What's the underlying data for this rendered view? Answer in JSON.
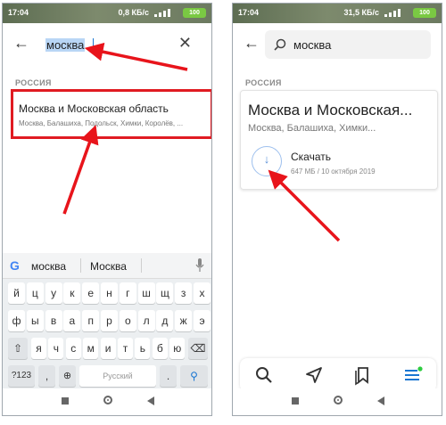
{
  "left": {
    "status": {
      "time": "17:04",
      "net": "0,8 КБ/с",
      "battery": "100"
    },
    "search": {
      "query": "москва"
    },
    "section_label": "РОССИЯ",
    "result": {
      "title": "Москва и Московская область",
      "subtitle": "Москва, Балашиха, Подольск, Химки, Королёв, ..."
    },
    "keyboard": {
      "suggestions": [
        "москва",
        "Москва"
      ],
      "row1": [
        "й",
        "ц",
        "у",
        "к",
        "е",
        "н",
        "г",
        "ш",
        "щ",
        "з",
        "х"
      ],
      "row2": [
        "ф",
        "ы",
        "в",
        "а",
        "п",
        "р",
        "о",
        "л",
        "д",
        "ж",
        "э"
      ],
      "row3": [
        "я",
        "ч",
        "с",
        "м",
        "и",
        "т",
        "ь",
        "б",
        "ю"
      ],
      "symbols_key": "?123",
      "comma": ",",
      "space_label": "Русский",
      "period": "."
    }
  },
  "right": {
    "status": {
      "time": "17:04",
      "net": "31,5 КБ/с",
      "battery": "100"
    },
    "search": {
      "query": "москва"
    },
    "section_label": "РОССИЯ",
    "card": {
      "title": "Москва и Московская...",
      "subtitle": "Москва, Балашиха, Химки...",
      "download_label": "Скачать",
      "download_meta": "647 МБ / 10 октября 2019"
    }
  },
  "colors": {
    "accent": "#1976d2",
    "highlight_red": "#e01b22",
    "arrow_red": "#e8141b",
    "battery_green": "#7ac943",
    "download_blue": "#5d92d9",
    "tab_dot_green": "#2ecc40"
  },
  "icons": [
    "back-arrow-icon",
    "clear-icon",
    "search-icon",
    "google-icon",
    "mic-icon",
    "backspace-icon",
    "globe-icon",
    "search-key-icon",
    "download-icon",
    "navigate-icon",
    "bookmarks-icon",
    "menu-icon"
  ]
}
